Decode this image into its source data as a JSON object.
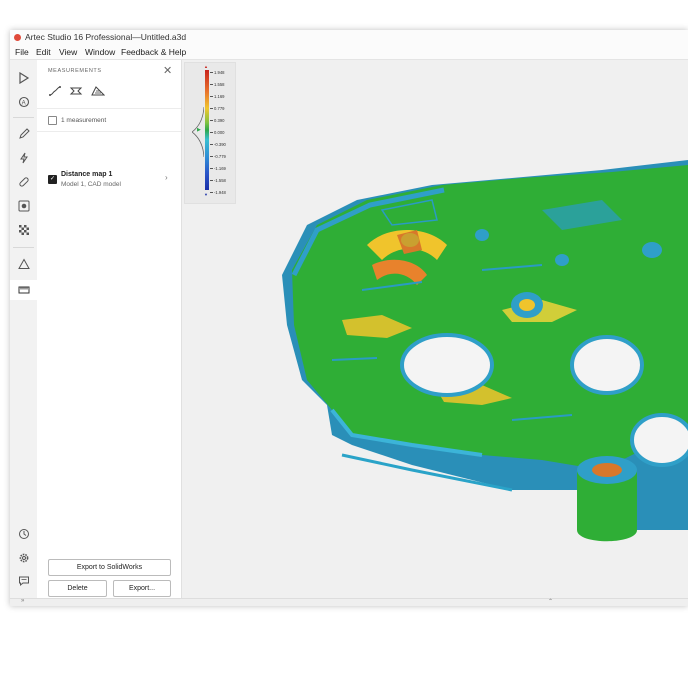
{
  "window": {
    "title": "Artec Studio 16 Professional—Untitled.a3d"
  },
  "menu": [
    "File",
    "Edit",
    "View",
    "Window",
    "Feedback & Help"
  ],
  "toolbar": {
    "icons": [
      "play-icon",
      "autopilot-icon",
      "pencil-icon",
      "lightning-icon",
      "bandage-icon",
      "target-icon",
      "texture-icon",
      "triangle-icon",
      "measurements-icon",
      "history-icon",
      "gear-icon",
      "chat-icon"
    ]
  },
  "panel": {
    "title": "MEASUREMENTS",
    "count_label": "1 measurement",
    "item": {
      "title": "Distance map 1",
      "subtitle": "Model 1, CAD model"
    },
    "buttons": {
      "export_solidworks": "Export to SolidWorks",
      "delete": "Delete",
      "export": "Export..."
    }
  },
  "scale": {
    "ticks": [
      "1.948",
      "1.558",
      "1.169",
      "0.779",
      "0.390",
      "0.000",
      "-0.390",
      "-0.779",
      "-1.169",
      "-1.558",
      "-1.948"
    ]
  },
  "colors": {
    "accent": "#e04a3a",
    "model_green": "#2fae36",
    "model_blue": "#2f9fc8",
    "model_yellow": "#f0c42c"
  }
}
